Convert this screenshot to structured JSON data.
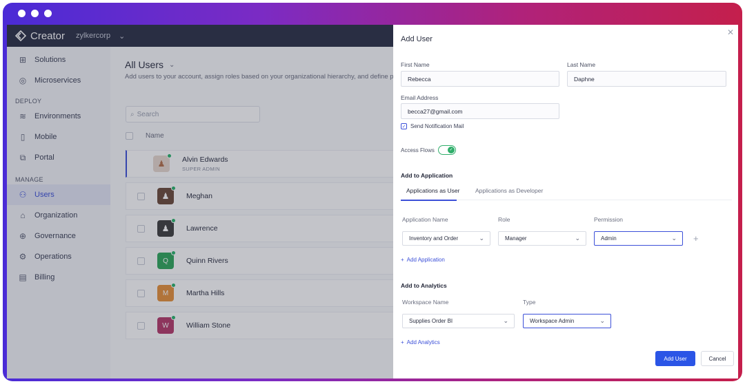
{
  "app": {
    "name": "Creator",
    "org": "zylkercorp"
  },
  "sidebar": {
    "top_items": [
      {
        "label": "Solutions",
        "icon": "grid-icon"
      },
      {
        "label": "Microservices",
        "icon": "microservice-icon"
      }
    ],
    "deploy_label": "DEPLOY",
    "deploy_items": [
      {
        "label": "Environments",
        "icon": "layers-icon"
      },
      {
        "label": "Mobile",
        "icon": "mobile-icon"
      },
      {
        "label": "Portal",
        "icon": "portal-icon"
      }
    ],
    "manage_label": "MANAGE",
    "manage_items": [
      {
        "label": "Users",
        "icon": "users-icon",
        "active": true
      },
      {
        "label": "Organization",
        "icon": "organization-icon"
      },
      {
        "label": "Governance",
        "icon": "governance-icon"
      },
      {
        "label": "Operations",
        "icon": "operations-icon"
      },
      {
        "label": "Billing",
        "icon": "billing-icon"
      }
    ]
  },
  "main": {
    "title": "All Users",
    "description": "Add users to your account, assign roles based on your organizational hierarchy, and define permissions",
    "search_placeholder": "Search",
    "column_name": "Name",
    "users": [
      {
        "name": "Alvin Edwards",
        "role": "SUPER ADMIN",
        "avatar_color": "#e8d9cf",
        "initial": ""
      },
      {
        "name": "Meghan",
        "role": "",
        "avatar_color": "#6b4a3a",
        "initial": ""
      },
      {
        "name": "Lawrence",
        "role": "",
        "avatar_color": "#3d3d3d",
        "initial": ""
      },
      {
        "name": "Quinn Rivers",
        "role": "",
        "avatar_color": "#2ea75a",
        "initial": "Q"
      },
      {
        "name": "Martha Hills",
        "role": "",
        "avatar_color": "#e7913a",
        "initial": "M"
      },
      {
        "name": "William Stone",
        "role": "",
        "avatar_color": "#b53a6a",
        "initial": "W"
      }
    ]
  },
  "panel": {
    "title": "Add User",
    "first_name_label": "First Name",
    "first_name_value": "Rebecca",
    "last_name_label": "Last Name",
    "last_name_value": "Daphne",
    "email_label": "Email Address",
    "email_value": "becca27@gmail.com",
    "send_notification_label": "Send Notification Mail",
    "send_notification_checked": true,
    "access_flows_label": "Access Flows",
    "access_flows_on": true,
    "add_to_application_label": "Add to Application",
    "tabs": [
      "Applications as User",
      "Applications as Developer"
    ],
    "app_name_col": "Application Name",
    "role_col": "Role",
    "permission_col": "Permission",
    "app_name_value": "Inventory and Order",
    "role_value": "Manager",
    "permission_value": "Admin",
    "add_application_link": "Add Application",
    "add_to_analytics_label": "Add to Analytics",
    "workspace_name_col": "Workspace Name",
    "type_col": "Type",
    "workspace_value": "Supplies Order BI",
    "type_value": "Workspace Admin",
    "add_analytics_link": "Add Analytics",
    "add_user_button": "Add User",
    "cancel_button": "Cancel"
  }
}
